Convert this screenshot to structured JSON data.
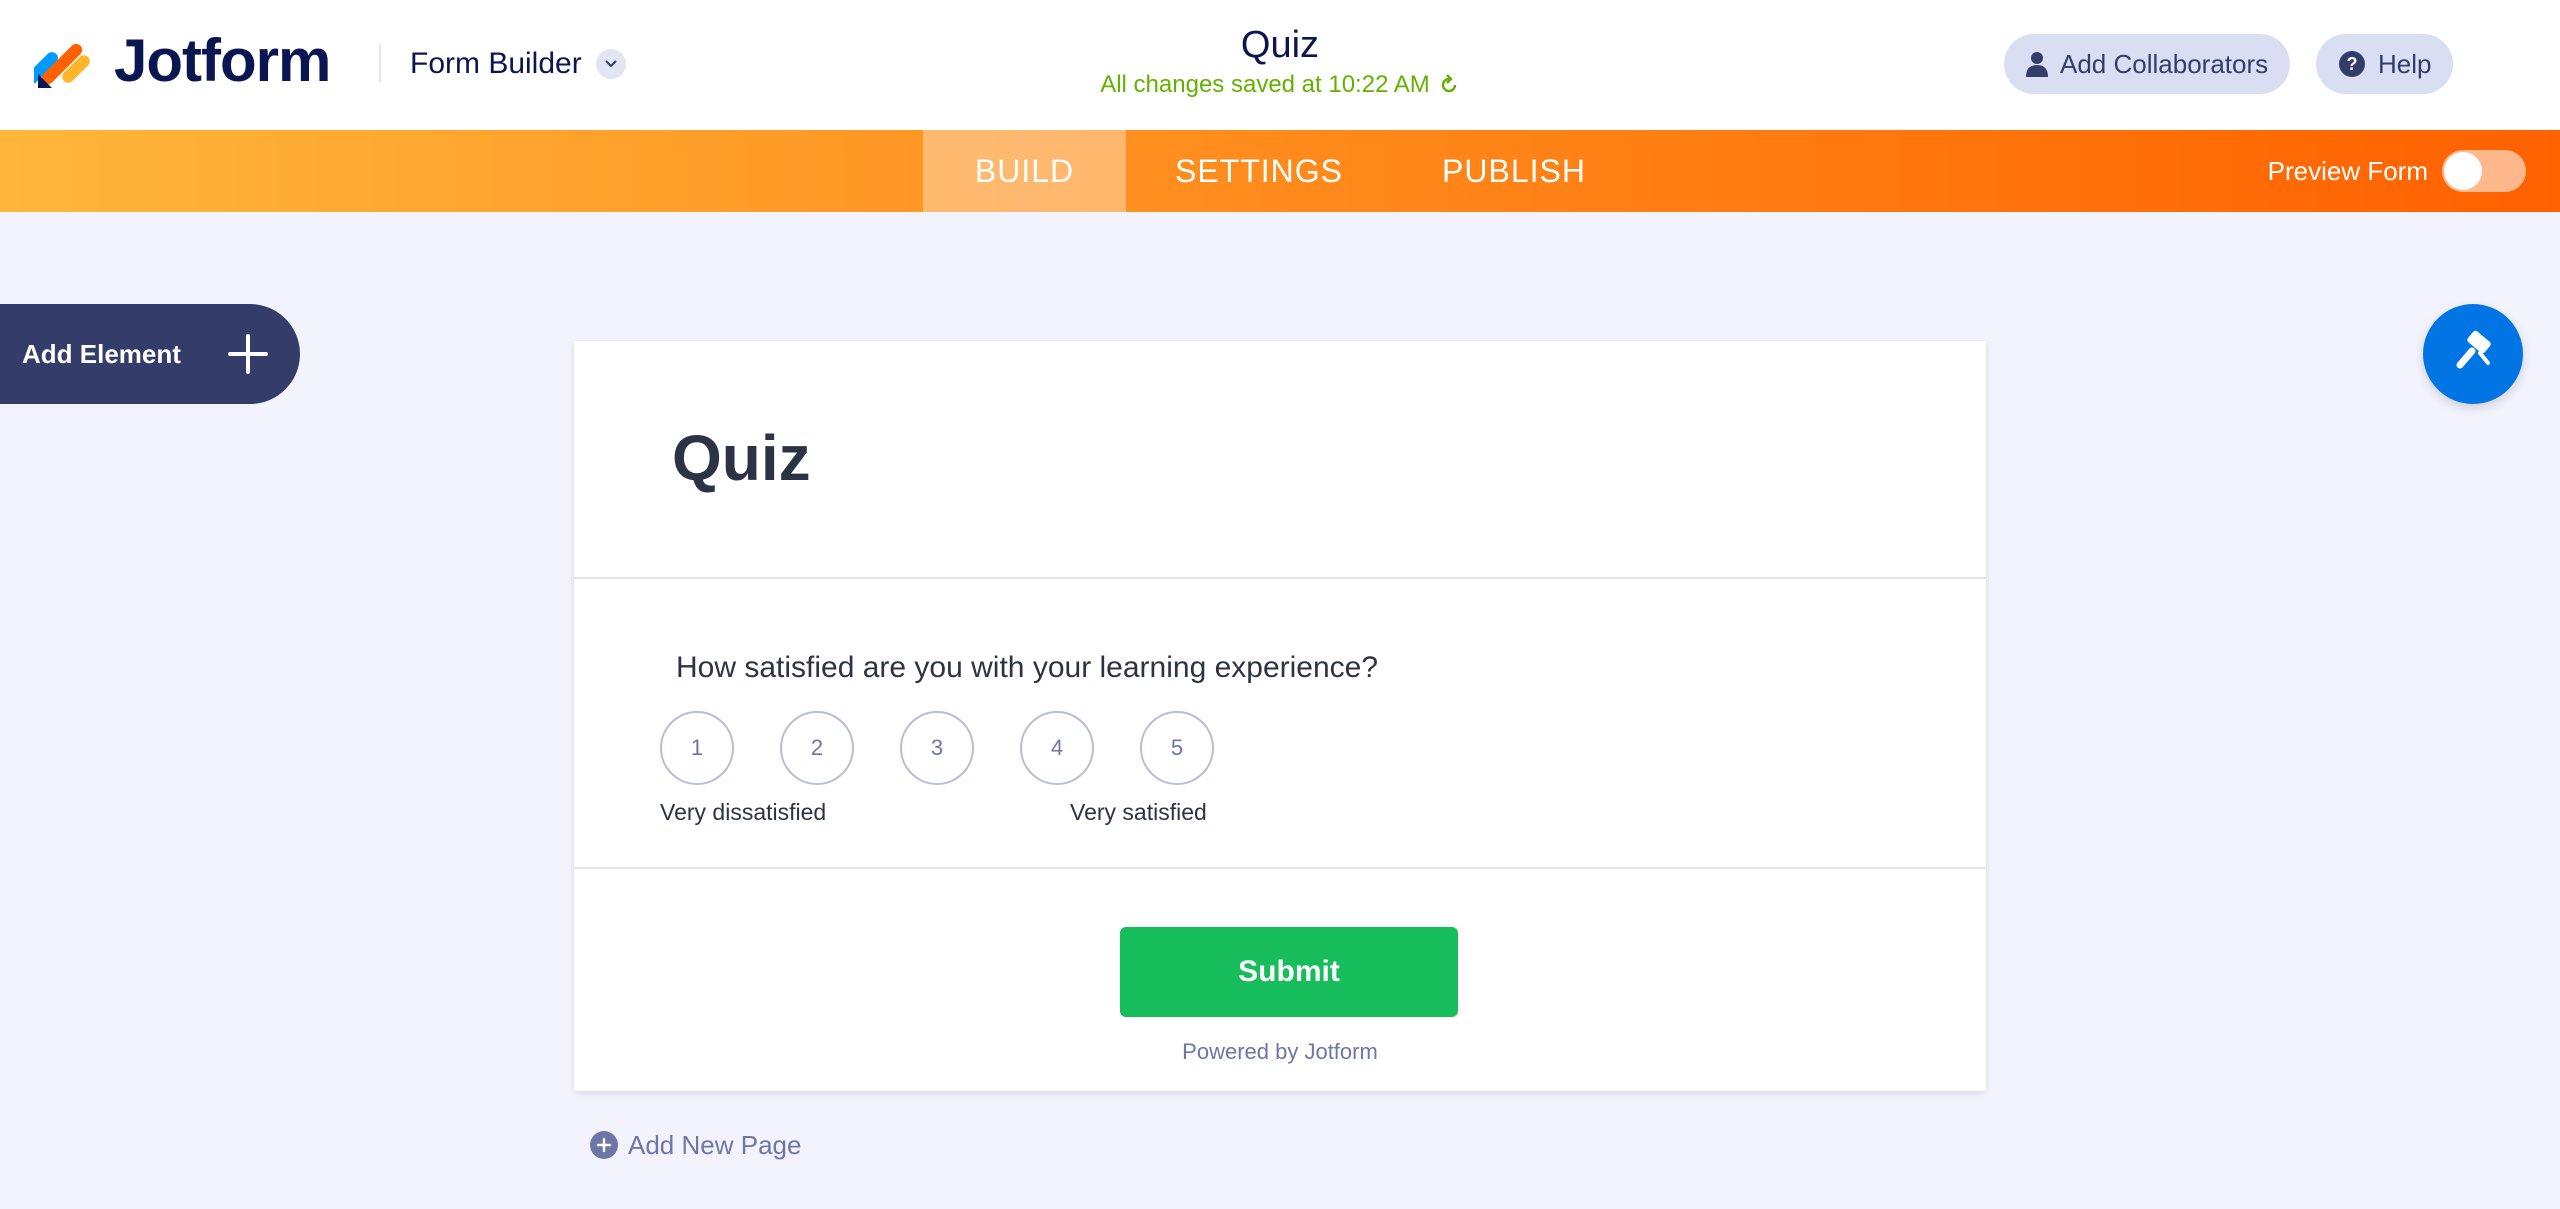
{
  "header": {
    "brand": "Jotform",
    "builder_menu": "Form Builder",
    "form_title": "Quiz",
    "save_status": "All changes saved at 10:22 AM",
    "add_collaborators": "Add Collaborators",
    "help": "Help"
  },
  "nav": {
    "tabs": [
      {
        "label": "BUILD",
        "active": true
      },
      {
        "label": "SETTINGS",
        "active": false
      },
      {
        "label": "PUBLISH",
        "active": false
      }
    ],
    "preview_label": "Preview Form",
    "preview_on": false
  },
  "sidebar": {
    "add_element": "Add Element"
  },
  "form": {
    "title": "Quiz",
    "question": {
      "label": "How satisfied are you with your learning experience?",
      "options": [
        "1",
        "2",
        "3",
        "4",
        "5"
      ],
      "low_label": "Very dissatisfied",
      "high_label": "Very satisfied"
    },
    "submit_label": "Submit",
    "powered_by": "Powered by Jotform"
  },
  "footer": {
    "add_new_page": "Add New Page"
  },
  "colors": {
    "brand_navy": "#0a1551",
    "save_green": "#64b200",
    "submit_green": "#18bd5b",
    "designer_blue": "#0075e3",
    "nav_orange_start": "#ffb63b",
    "nav_orange_end": "#ff6100"
  }
}
